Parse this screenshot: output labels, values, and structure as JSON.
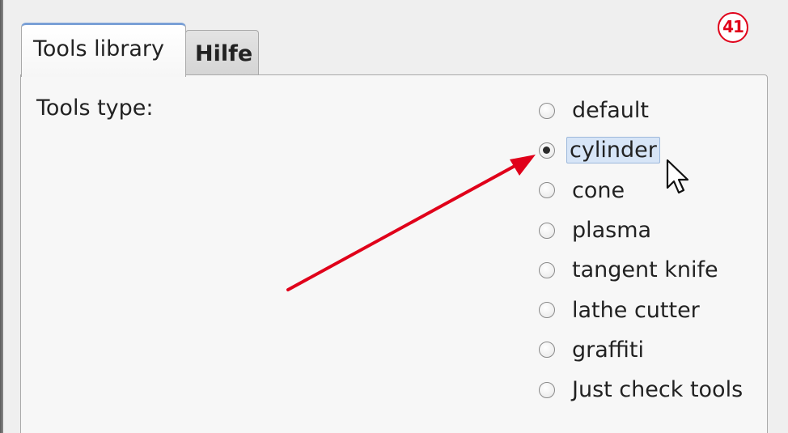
{
  "badge": {
    "number": "41"
  },
  "tabs": [
    {
      "label": "Tools library",
      "active": true
    },
    {
      "label": "Hilfe",
      "active": false
    }
  ],
  "panel": {
    "tools_type_label": "Tools type:",
    "options": [
      {
        "label": "default",
        "checked": false
      },
      {
        "label": "cylinder",
        "checked": true
      },
      {
        "label": "cone",
        "checked": false
      },
      {
        "label": "plasma",
        "checked": false
      },
      {
        "label": "tangent knife",
        "checked": false
      },
      {
        "label": "lathe cutter",
        "checked": false
      },
      {
        "label": "graffiti",
        "checked": false
      },
      {
        "label": "Just check tools",
        "checked": false
      }
    ]
  },
  "colors": {
    "annotation_red": "#e0001a",
    "focus_highlight": "#d7e5f7",
    "active_tab_accent": "#7aa0d6"
  },
  "icons": {
    "cursor": "mouse-pointer-icon",
    "annotation_arrow": "red-arrow-annotation"
  }
}
